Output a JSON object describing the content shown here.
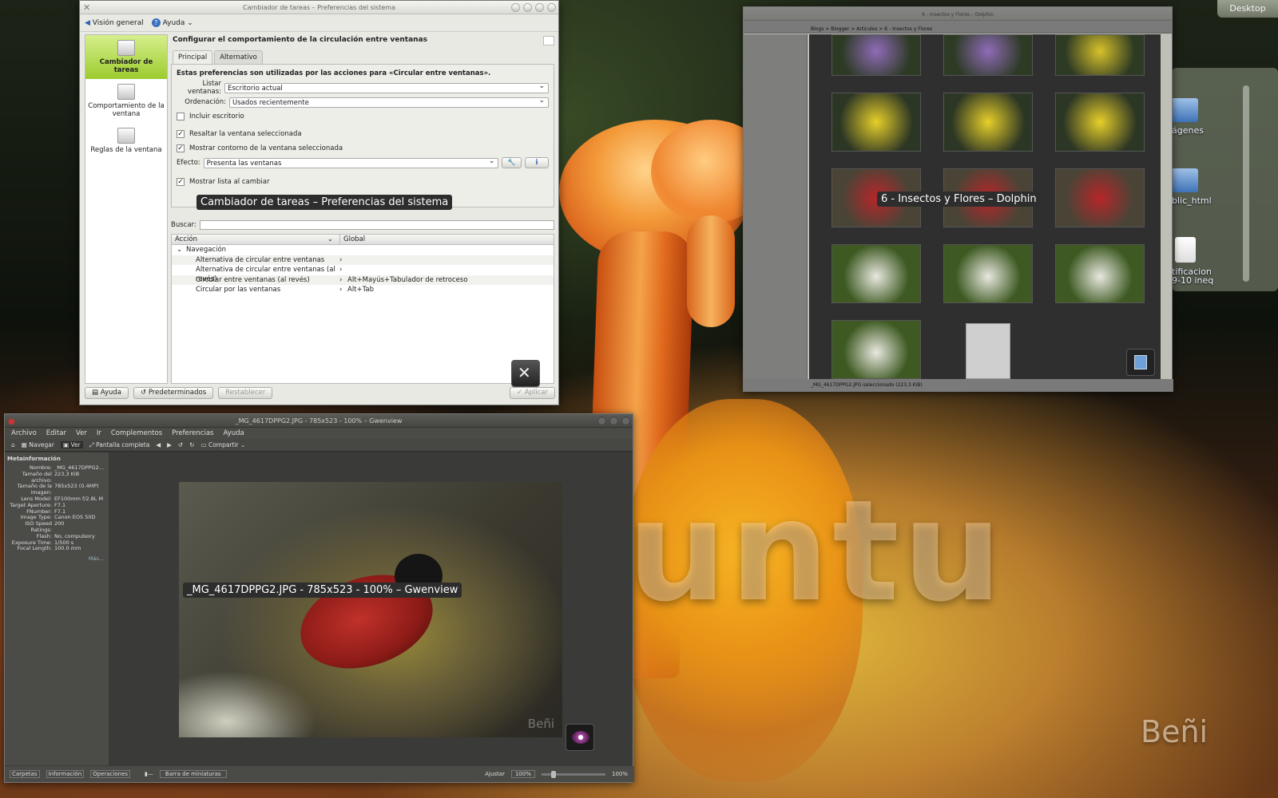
{
  "desktop": {
    "watermark": "untu",
    "signature": "Beñi",
    "desktop_button": "Desktop",
    "icons": [
      {
        "label": "ágenes"
      },
      {
        "label": "blic_html"
      },
      {
        "label": "tificacion"
      },
      {
        "label": "9-10 ineq"
      }
    ]
  },
  "prefs_window": {
    "title": "Cambiador de tareas – Preferencias del sistema",
    "toolbar": {
      "overview": "Visión general",
      "help": "Ayuda"
    },
    "sidebar": [
      {
        "label": "Cambiador de tareas"
      },
      {
        "label": "Comportamiento de la ventana"
      },
      {
        "label": "Reglas de la ventana"
      }
    ],
    "heading": "Configurar el comportamiento de la circulación entre ventanas",
    "tabs": [
      "Principal",
      "Alternativo"
    ],
    "intro": "Estas preferencias son utilizadas por las acciones para «Circular entre ventanas».",
    "list_windows_label": "Listar ventanas:",
    "list_windows_value": "Escritorio actual",
    "order_label": "Ordenación:",
    "order_value": "Usados recientemente",
    "include_desktop": "Incluir escritorio",
    "highlight_selected": "Resaltar la ventana seleccionada",
    "show_outline": "Mostrar contorno de la ventana seleccionada",
    "effect_label": "Efecto:",
    "effect_value": "Presenta las ventanas",
    "show_list": "Mostrar lista al cambiar",
    "search_label": "Buscar:",
    "columns": [
      "Acción",
      "Global"
    ],
    "group": "Navegación",
    "shortcuts": [
      {
        "action": "Alternativa de circular entre ventanas",
        "global": ""
      },
      {
        "action": "Alternativa de circular entre ventanas (al revés)",
        "global": ""
      },
      {
        "action": "Circular entre ventanas (al revés)",
        "global": "Alt+Mayús+Tabulador de retroceso"
      },
      {
        "action": "Circular por las ventanas",
        "global": "Alt+Tab"
      }
    ],
    "footer": {
      "help": "Ayuda",
      "defaults": "Predeterminados",
      "reset": "Restablecer",
      "apply": "Aplicar"
    }
  },
  "tooltips": {
    "prefs": "Cambiador de tareas – Preferencias del sistema",
    "dolphin": "6 - Insectos y Flores – Dolphin",
    "gwenview": "_MG_4617DPPG2.JPG - 785x523 - 100% – Gwenview"
  },
  "gwenview": {
    "title": "_MG_4617DPPG2.JPG - 785x523 - 100% – Gwenview",
    "menu": [
      "Archivo",
      "Editar",
      "Ver",
      "Ir",
      "Complementos",
      "Preferencias",
      "Ayuda"
    ],
    "toolbar": {
      "browse": "Navegar",
      "view": "Ver",
      "fullscreen": "Pantalla completa",
      "share": "Compartir"
    },
    "meta_title": "Metainformación",
    "meta": [
      {
        "k": "Nombre:",
        "v": "_MG_4617DPPG2..."
      },
      {
        "k": "Tamaño del archivo:",
        "v": "223,3 KiB"
      },
      {
        "k": "Tamaño de la imagen:",
        "v": "785x523 (0.4MP)"
      },
      {
        "k": "Lens Model:",
        "v": "EF100mm f/2.8L M"
      },
      {
        "k": "Target Aperture:",
        "v": "F7.1"
      },
      {
        "k": "FNumber:",
        "v": "F7.1"
      },
      {
        "k": "Image Type:",
        "v": "Canon EOS 50D"
      },
      {
        "k": "ISO Speed Ratings:",
        "v": "200"
      },
      {
        "k": "Flash:",
        "v": "No, compulsory"
      },
      {
        "k": "Exposure Time:",
        "v": "1/500 s"
      },
      {
        "k": "Focal Length:",
        "v": "100.0 mm"
      }
    ],
    "more": "Más...",
    "image_signature": "Beñi",
    "status": {
      "tabs": [
        "Carpetas",
        "Información",
        "Operaciones"
      ],
      "thumbbar": "Barra de miniaturas",
      "fit": "Ajustar",
      "zoom": "100%",
      "zoom2": "100%"
    }
  },
  "dolphin": {
    "title": "6 - Insectos y Flores – Dolphin",
    "breadcrumb": "Blogs > Blogger > Articulos > 6 - Insectos y Flores",
    "status": "_MG_4617DPPG2.JPG seleccionado (223,3 KiB)"
  }
}
